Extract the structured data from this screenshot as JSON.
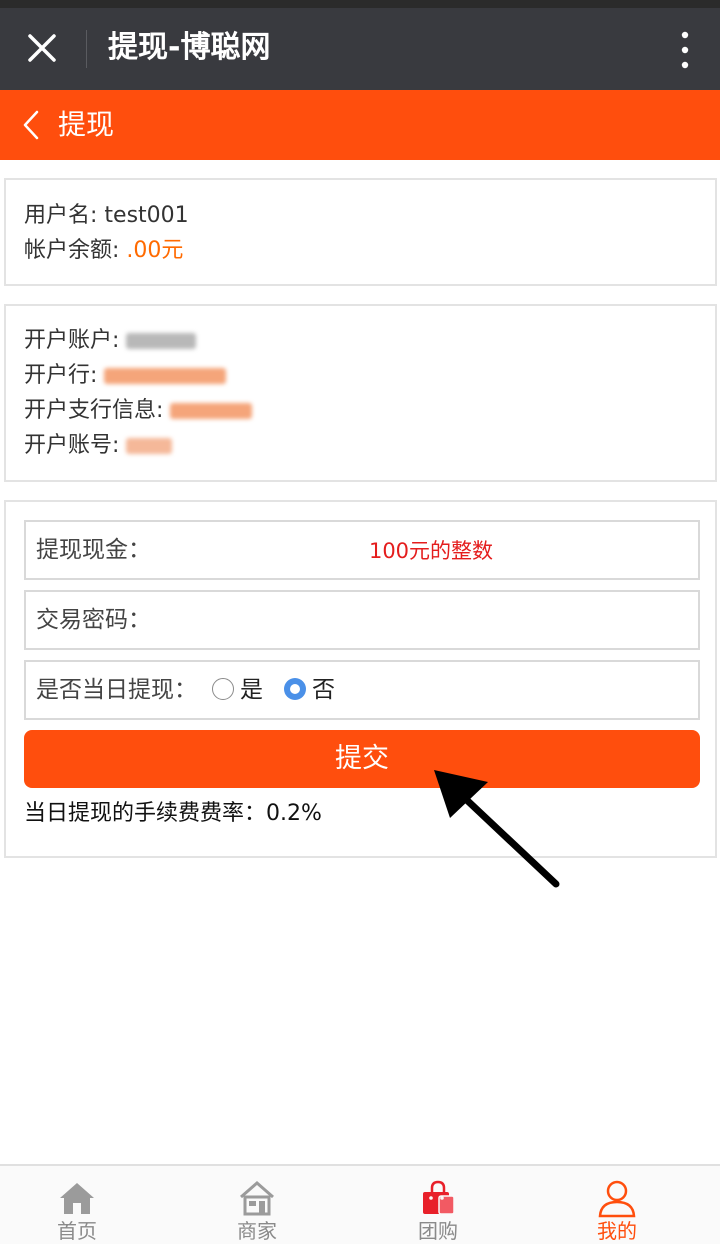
{
  "window": {
    "title": "提现-博聪网"
  },
  "nav": {
    "title": "提现"
  },
  "account": {
    "username_label": "用户名: ",
    "username": "test001",
    "balance_label": "帐户余额: ",
    "balance": ".00元"
  },
  "bank": {
    "holder_label": "开户账户: ",
    "bank_label": "开户行: ",
    "branch_label": "开户支行信息: ",
    "number_label": "开户账号: "
  },
  "form": {
    "cash_label": "提现现金：",
    "cash_placeholder": "100元的整数",
    "password_label": "交易密码：",
    "password_placeholder": "",
    "sameday_label": "是否当日提现：",
    "option_yes": "是",
    "option_no": "否",
    "selected": "否",
    "submit_label": "提交",
    "fee_note": "当日提现的手续费费率：0.2%"
  },
  "tabs": [
    {
      "label": "首页",
      "icon": "home-icon",
      "active": false
    },
    {
      "label": "商家",
      "icon": "store-icon",
      "active": false
    },
    {
      "label": "团购",
      "icon": "shopping-bag-icon",
      "active": false
    },
    {
      "label": "我的",
      "icon": "user-icon",
      "active": true
    }
  ],
  "colors": {
    "accent": "#ff4e0d",
    "titlebar": "#393a3f",
    "balance": "#ff6a00",
    "placeholder": "#e41d1d",
    "radio_selected": "#4a90e8"
  }
}
